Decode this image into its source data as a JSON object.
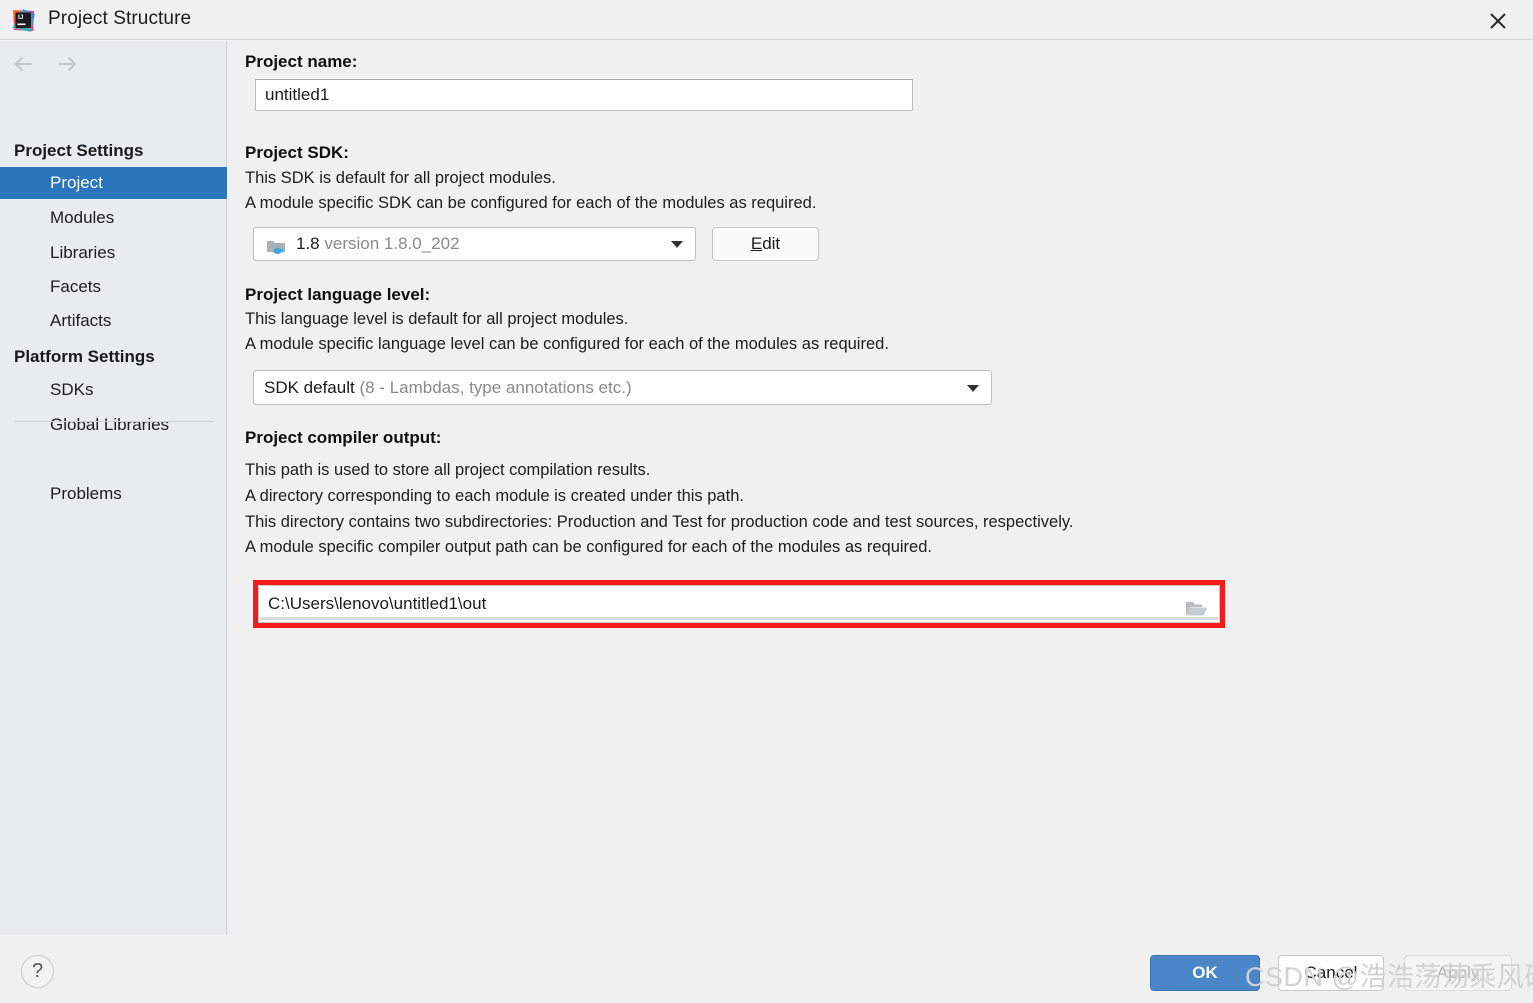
{
  "window": {
    "title": "Project Structure",
    "app_icon": "intellij-idea-icon",
    "close_icon": "close-icon"
  },
  "sidebar": {
    "nav": {
      "back_icon": "arrow-left-icon",
      "forward_icon": "arrow-right-icon"
    },
    "groups": [
      {
        "label": "Project Settings",
        "items": [
          {
            "label": "Project",
            "selected": true
          },
          {
            "label": "Modules",
            "selected": false
          },
          {
            "label": "Libraries",
            "selected": false
          },
          {
            "label": "Facets",
            "selected": false
          },
          {
            "label": "Artifacts",
            "selected": false
          }
        ]
      },
      {
        "label": "Platform Settings",
        "items": [
          {
            "label": "SDKs",
            "selected": false
          },
          {
            "label": "Global Libraries",
            "selected": false
          }
        ]
      }
    ],
    "extra_items": [
      {
        "label": "Problems",
        "selected": false
      }
    ]
  },
  "main": {
    "project_name": {
      "label": "Project name:",
      "value": "untitled1"
    },
    "project_sdk": {
      "label": "Project SDK:",
      "desc_line1": "This SDK is default for all project modules.",
      "desc_line2": "A module specific SDK can be configured for each of the modules as required.",
      "selected_primary": "1.8",
      "selected_secondary": "version 1.8.0_202",
      "icon": "java-sdk-folder-icon",
      "caret_icon": "chevron-down-icon",
      "edit_button": {
        "mnemonic": "E",
        "rest": "dit"
      }
    },
    "language_level": {
      "label": "Project language level:",
      "desc_line1": "This language level is default for all project modules.",
      "desc_line2": "A module specific language level can be configured for each of the modules as required.",
      "selected_primary": "SDK default",
      "selected_secondary": "(8 - Lambdas, type annotations etc.)",
      "caret_icon": "chevron-down-icon"
    },
    "compiler_output": {
      "label": "Project compiler output:",
      "desc_line1": "This path is used to store all project compilation results.",
      "desc_line2": "A directory corresponding to each module is created under this path.",
      "desc_line3": "This directory contains two subdirectories: Production and Test for production code and test sources, respectively.",
      "desc_line4": "A module specific compiler output path can be configured for each of the modules as required.",
      "value": "C:\\Users\\lenovo\\untitled1\\out",
      "browse_icon": "folder-open-icon",
      "highlight_color": "#f51b1b"
    }
  },
  "footer": {
    "help_label": "?",
    "ok_label": "OK",
    "cancel_label": "Cancel",
    "apply_label": "Apply"
  },
  "watermark": {
    "text": "CSDN @浩浩荡荡乘风破浪"
  },
  "colors": {
    "accent_blue": "#2a75bb",
    "ok_button_blue": "#4a86c8",
    "sidebar_bg": "#e7ecf0",
    "main_bg": "#f0f0f0",
    "highlight_red": "#f51b1b"
  }
}
